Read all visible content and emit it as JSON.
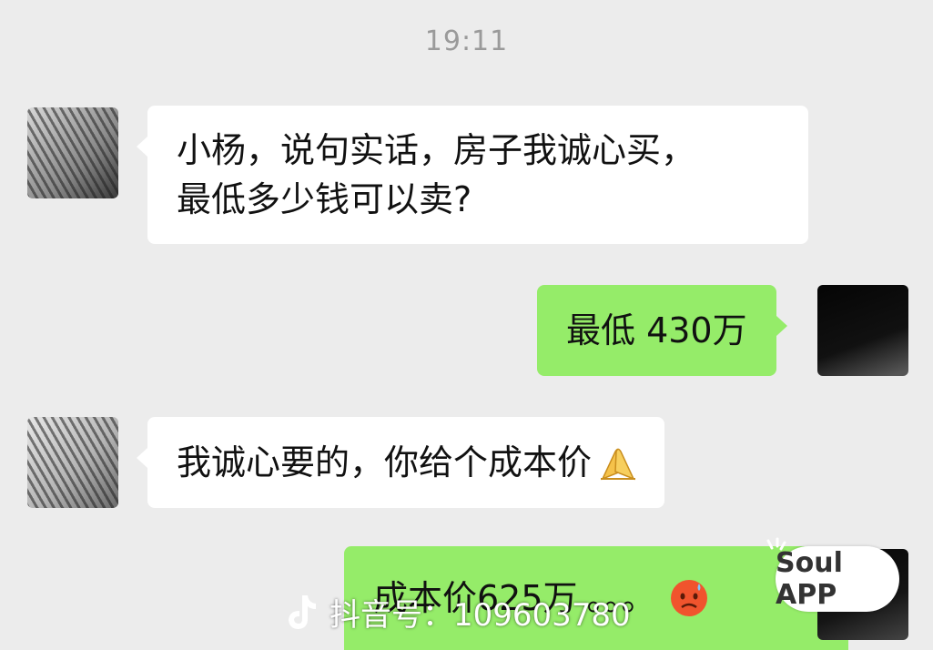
{
  "chat": {
    "timestamp": "19:11",
    "messages": [
      {
        "side": "left",
        "lines": [
          "小杨，说句实话，房子我诚心买，",
          "最低多少钱可以卖?"
        ]
      },
      {
        "side": "right",
        "text": "最低 430万"
      },
      {
        "side": "left",
        "text": "我诚心要的，你给个成本价",
        "emoji": "folded-hands"
      },
      {
        "side": "right",
        "text": "成本价625万",
        "suffix": "。。。",
        "emoji": "hot-face"
      }
    ]
  },
  "watermarks": {
    "douyin": "抖音号：109603780",
    "soul": "Soul APP"
  },
  "colors": {
    "background": "#ececec",
    "incoming_bubble": "#ffffff",
    "outgoing_bubble": "#95ec69",
    "timestamp": "#9a9a9a"
  }
}
